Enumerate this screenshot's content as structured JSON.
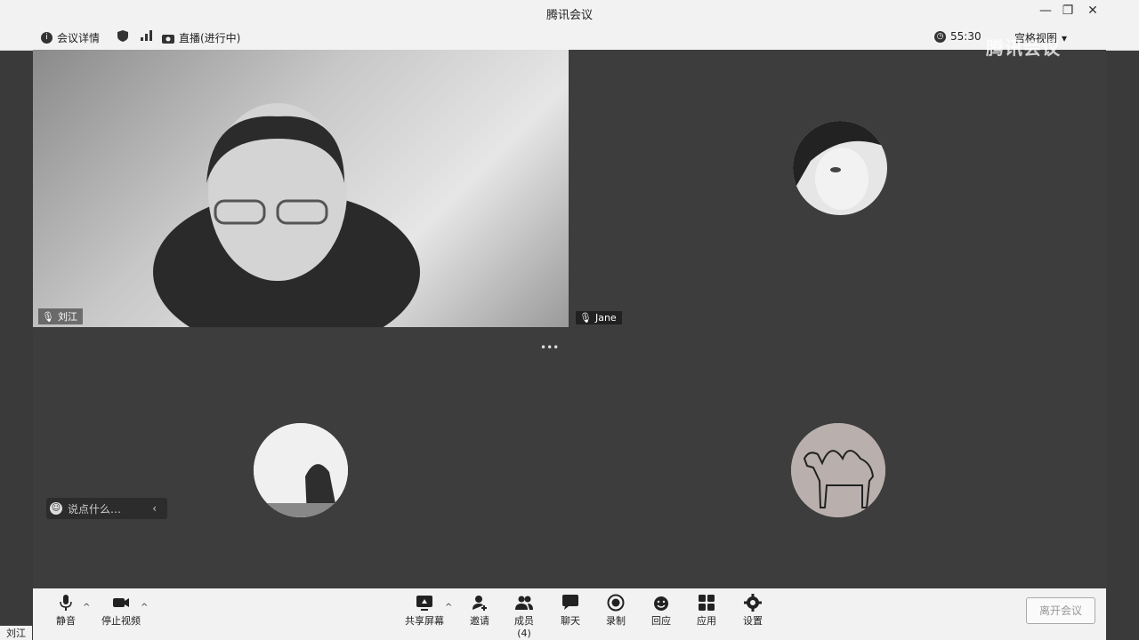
{
  "window": {
    "title": "腾讯会议",
    "controls": [
      "—",
      "❐",
      "✕"
    ]
  },
  "infobar": {
    "details": "会议详情",
    "live": "直播(进行中)",
    "timer": "55:30",
    "view": "宫格视图"
  },
  "watermark": "腾讯会议",
  "participants": [
    {
      "name": "刘江",
      "type": "video"
    },
    {
      "name": "Jane",
      "type": "avatar",
      "avatar_color": "#e6e6e6"
    },
    {
      "name": "",
      "type": "avatar",
      "avatar_color": "#f0f0f0"
    },
    {
      "name": "",
      "type": "avatar",
      "avatar_color": "#b9b0ad"
    }
  ],
  "more_menu": "•••",
  "chat": {
    "placeholder": "说点什么…",
    "collapse": "‹"
  },
  "toolbar": {
    "mute": "静音",
    "stop_video": "停止视频",
    "share": "共享屏幕",
    "invite": "邀请",
    "members": "成员(4)",
    "chat": "聊天",
    "record": "录制",
    "reactions": "回应",
    "apps": "应用",
    "settings": "设置",
    "leave": "离开会议"
  },
  "corner_label": "刘江"
}
